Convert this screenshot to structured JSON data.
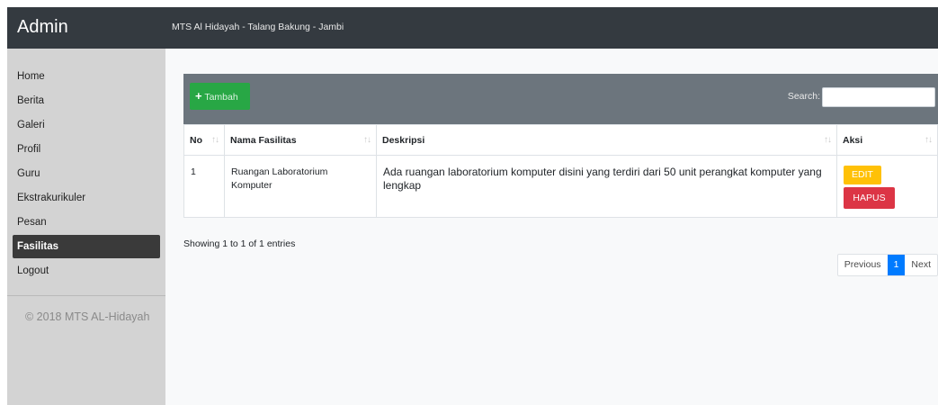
{
  "sidebar": {
    "brand": "Admin",
    "items": [
      {
        "label": "Home",
        "active": false
      },
      {
        "label": "Berita",
        "active": false
      },
      {
        "label": "Galeri",
        "active": false
      },
      {
        "label": "Profil",
        "active": false
      },
      {
        "label": "Guru",
        "active": false
      },
      {
        "label": "Ekstrakurikuler",
        "active": false
      },
      {
        "label": "Pesan",
        "active": false
      },
      {
        "label": "Fasilitas",
        "active": true
      },
      {
        "label": "Logout",
        "active": false
      }
    ],
    "copyright": "© 2018 MTS AL-Hidayah"
  },
  "header": {
    "title": "MTS Al Hidayah - Talang Bakung - Jambi"
  },
  "toolbar": {
    "add_label": "Tambah",
    "search_label": "Search:",
    "search_value": ""
  },
  "table": {
    "columns": [
      "No",
      "Nama Fasilitas",
      "Deskripsi",
      "Aksi"
    ],
    "rows": [
      {
        "no": "1",
        "nama": "Ruangan Laboratorium Komputer",
        "deskripsi": "Ada ruangan laboratorium komputer disini yang terdiri dari 50 unit perangkat komputer yang lengkap",
        "edit_label": "EDIT",
        "delete_label": "HAPUS"
      }
    ]
  },
  "footer": {
    "info": "Showing 1 to 1 of 1 entries",
    "previous_label": "Previous",
    "current_page": "1",
    "next_label": "Next"
  },
  "colors": {
    "sidebar_bg": "#d3d3d3",
    "topbar_bg": "#343a40",
    "toolbar_bg": "#6c757d",
    "add_button": "#28a745",
    "edit_button": "#ffc107",
    "delete_button": "#dc3545",
    "active_page": "#007bff"
  }
}
